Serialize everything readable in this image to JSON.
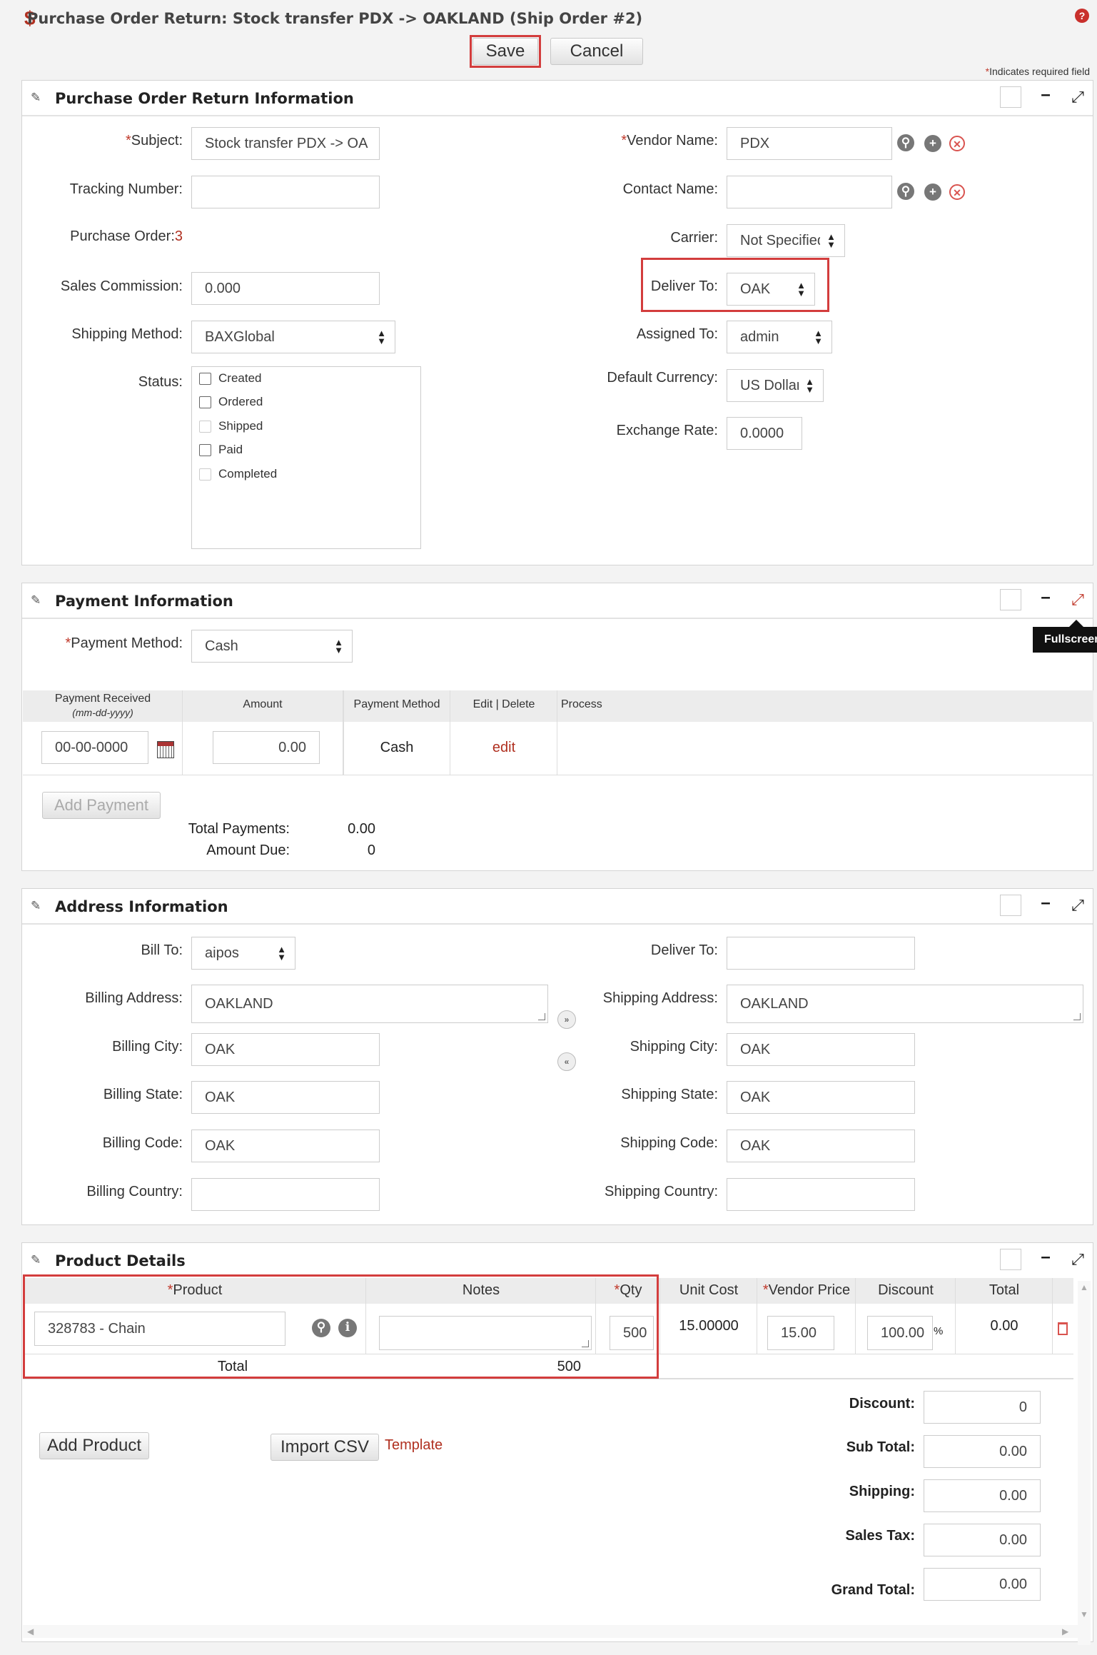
{
  "header": {
    "title": "Purchase Order Return: Stock transfer PDX -> OAKLAND (Ship Order #2)",
    "save_label": "Save",
    "cancel_label": "Cancel",
    "help_label": "?",
    "required_note": "Indicates required field"
  },
  "info": {
    "title": "Purchase Order Return Information",
    "subject_label": "Subject:",
    "subject_value": "Stock transfer PDX -> OA",
    "tracking_label": "Tracking Number:",
    "tracking_value": "",
    "po_label": "Purchase Order:",
    "po_value": "3",
    "commission_label": "Sales Commission:",
    "commission_value": "0.000",
    "shipping_method_label": "Shipping Method:",
    "shipping_method_value": "BAXGlobal",
    "status_label": "Status:",
    "statuses": [
      {
        "label": "Created",
        "enabled": true
      },
      {
        "label": "Ordered",
        "enabled": true
      },
      {
        "label": "Shipped",
        "enabled": false
      },
      {
        "label": "Paid",
        "enabled": true
      },
      {
        "label": "Completed",
        "enabled": false
      }
    ],
    "vendor_label": "Vendor Name:",
    "vendor_value": "PDX",
    "contact_label": "Contact Name:",
    "contact_value": "",
    "carrier_label": "Carrier:",
    "carrier_value": "Not Specified",
    "deliver_label": "Deliver To:",
    "deliver_value": "OAK",
    "assigned_label": "Assigned To:",
    "assigned_value": "admin",
    "currency_label": "Default Currency:",
    "currency_value": "US Dollar",
    "exchange_label": "Exchange Rate:",
    "exchange_value": "0.0000"
  },
  "payment": {
    "title": "Payment Information",
    "tooltip": "Fullscreen",
    "method_label": "Payment Method:",
    "method_value": "Cash",
    "columns": {
      "received": "Payment Received",
      "received_fmt": "(mm-dd-yyyy)",
      "amount": "Amount",
      "method": "Payment Method",
      "edit_delete": "Edit | Delete",
      "process": "Process"
    },
    "row": {
      "date": "00-00-0000",
      "amount": "0.00",
      "method": "Cash",
      "edit": "edit"
    },
    "add_label": "Add Payment",
    "total_payments_label": "Total Payments:",
    "total_payments_value": "0.00",
    "amount_due_label": "Amount Due:",
    "amount_due_value": "0"
  },
  "address": {
    "title": "Address Information",
    "bill_to_label": "Bill To:",
    "bill_to_value": "aipos",
    "deliver_to_label": "Deliver To:",
    "deliver_to_value": "",
    "billing_address_label": "Billing Address:",
    "billing_address_value": "OAKLAND",
    "shipping_address_label": "Shipping Address:",
    "shipping_address_value": "OAKLAND",
    "billing_city_label": "Billing City:",
    "billing_city_value": "OAK",
    "shipping_city_label": "Shipping City:",
    "shipping_city_value": "OAK",
    "billing_state_label": "Billing State:",
    "billing_state_value": "OAK",
    "shipping_state_label": "Shipping State:",
    "shipping_state_value": "OAK",
    "billing_code_label": "Billing Code:",
    "billing_code_value": "OAK",
    "shipping_code_label": "Shipping Code:",
    "shipping_code_value": "OAK",
    "billing_country_label": "Billing Country:",
    "billing_country_value": "",
    "shipping_country_label": "Shipping Country:",
    "shipping_country_value": ""
  },
  "products": {
    "title": "Product Details",
    "columns": {
      "product": "Product",
      "notes": "Notes",
      "qty": "Qty",
      "unit_cost": "Unit Cost",
      "vendor_price": "Vendor Price",
      "discount": "Discount",
      "total": "Total"
    },
    "row": {
      "product": "328783 - Chain",
      "notes": "",
      "qty": "500",
      "unit_cost": "15.00000",
      "vendor_price": "15.00",
      "discount": "100.00",
      "pct": "%",
      "total": "0.00"
    },
    "total_label": "Total",
    "total_qty": "500",
    "add_product_label": "Add Product",
    "import_label": "Import CSV",
    "template_label": "Template",
    "discount_label": "Discount:",
    "discount_value": "0",
    "subtotal_label": "Sub Total:",
    "subtotal_value": "0.00",
    "shipping_label": "Shipping:",
    "shipping_value": "0.00",
    "tax_label": "Sales Tax:",
    "tax_value": "0.00",
    "grand_label": "Grand Total:",
    "grand_value": "0.00"
  }
}
